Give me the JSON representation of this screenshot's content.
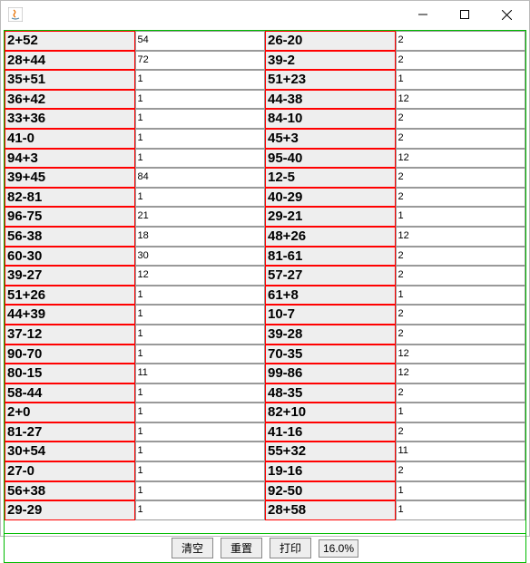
{
  "window": {
    "title": ""
  },
  "left": [
    {
      "q": "2+52",
      "a": "54"
    },
    {
      "q": "28+44",
      "a": "72"
    },
    {
      "q": "35+51",
      "a": "1"
    },
    {
      "q": "36+42",
      "a": "1"
    },
    {
      "q": "33+36",
      "a": "1"
    },
    {
      "q": "41-0",
      "a": "1"
    },
    {
      "q": "94+3",
      "a": "1"
    },
    {
      "q": "39+45",
      "a": "84"
    },
    {
      "q": "82-81",
      "a": "1"
    },
    {
      "q": "96-75",
      "a": "21"
    },
    {
      "q": "56-38",
      "a": "18"
    },
    {
      "q": "60-30",
      "a": "30"
    },
    {
      "q": "39-27",
      "a": "12"
    },
    {
      "q": "51+26",
      "a": "1"
    },
    {
      "q": "44+39",
      "a": "1"
    },
    {
      "q": "37-12",
      "a": "1"
    },
    {
      "q": "90-70",
      "a": "1"
    },
    {
      "q": "80-15",
      "a": "11"
    },
    {
      "q": "58-44",
      "a": "1"
    },
    {
      "q": "2+0",
      "a": "1"
    },
    {
      "q": "81-27",
      "a": "1"
    },
    {
      "q": "30+54",
      "a": "1"
    },
    {
      "q": "27-0",
      "a": "1"
    },
    {
      "q": "56+38",
      "a": "1"
    },
    {
      "q": "29-29",
      "a": "1"
    }
  ],
  "right": [
    {
      "q": "26-20",
      "a": "2"
    },
    {
      "q": "39-2",
      "a": "2"
    },
    {
      "q": "51+23",
      "a": "1"
    },
    {
      "q": "44-38",
      "a": "12"
    },
    {
      "q": "84-10",
      "a": "2"
    },
    {
      "q": "45+3",
      "a": "2"
    },
    {
      "q": "95-40",
      "a": "12"
    },
    {
      "q": "12-5",
      "a": "2"
    },
    {
      "q": "40-29",
      "a": "2"
    },
    {
      "q": "29-21",
      "a": "1"
    },
    {
      "q": "48+26",
      "a": "12"
    },
    {
      "q": "81-61",
      "a": "2"
    },
    {
      "q": "57-27",
      "a": "2"
    },
    {
      "q": "61+8",
      "a": "1"
    },
    {
      "q": "10-7",
      "a": "2"
    },
    {
      "q": "39-28",
      "a": "2"
    },
    {
      "q": "70-35",
      "a": "12"
    },
    {
      "q": "99-86",
      "a": "12"
    },
    {
      "q": "48-35",
      "a": "2"
    },
    {
      "q": "82+10",
      "a": "1"
    },
    {
      "q": "41-16",
      "a": "2"
    },
    {
      "q": "55+32",
      "a": "11"
    },
    {
      "q": "19-16",
      "a": "2"
    },
    {
      "q": "92-50",
      "a": "1"
    },
    {
      "q": "28+58",
      "a": "1"
    }
  ],
  "toolbar": {
    "clear": "清空",
    "reset": "重置",
    "print": "打印",
    "percent": "16.0%"
  }
}
